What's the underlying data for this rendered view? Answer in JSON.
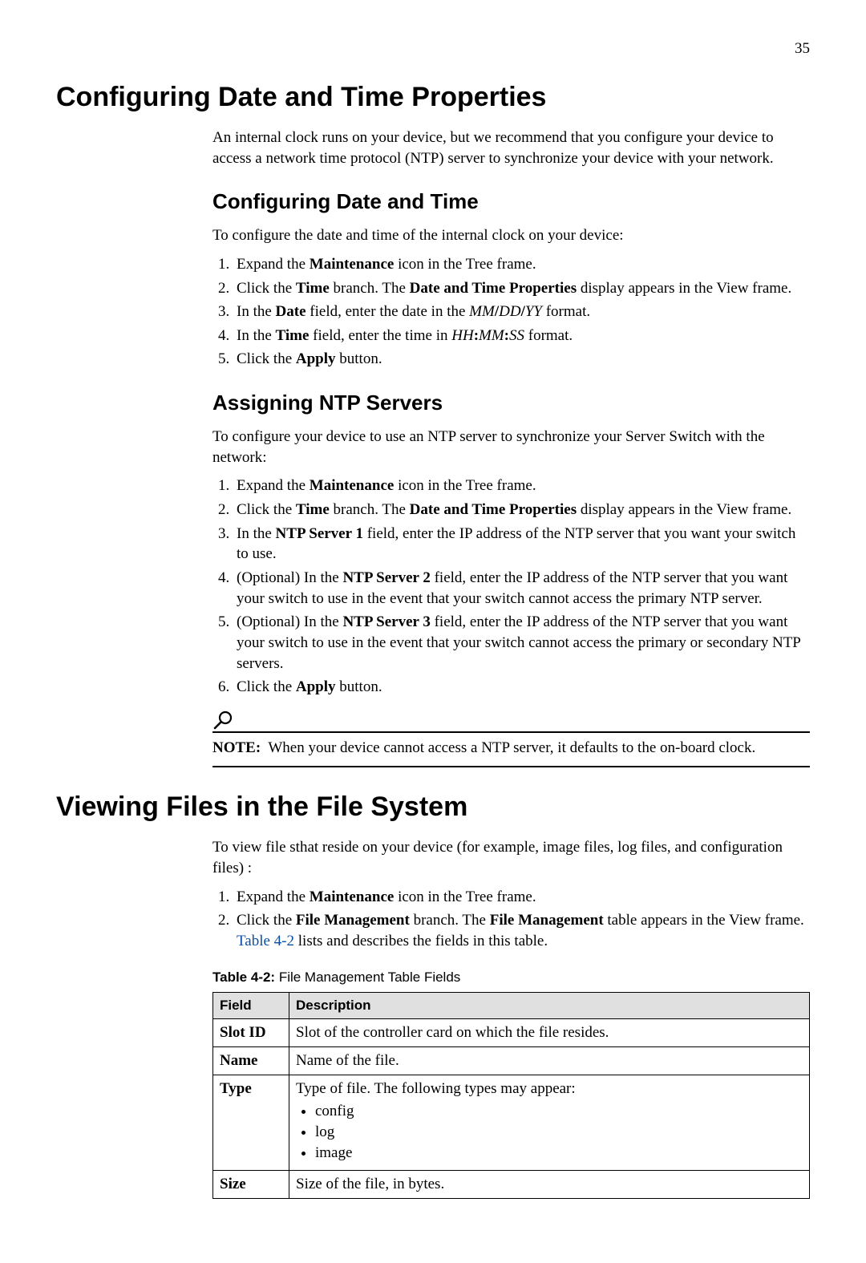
{
  "page_number": "35",
  "h1_a": "Configuring Date and Time Properties",
  "intro_a": "An internal clock runs on your device, but we recommend that you configure your device to access a network time protocol (NTP) server to synchronize your device with your network.",
  "h2_a": "Configuring Date and Time",
  "p_a": "To configure the date and time of the internal clock on your device:",
  "steps_a": [
    [
      {
        "t": "Expand the "
      },
      {
        "t": "Maintenance",
        "b": true
      },
      {
        "t": " icon in the Tree frame."
      }
    ],
    [
      {
        "t": "Click the "
      },
      {
        "t": "Time",
        "b": true
      },
      {
        "t": " branch. The "
      },
      {
        "t": "Date and Time Properties",
        "b": true
      },
      {
        "t": " display appears in the View frame."
      }
    ],
    [
      {
        "t": "In the "
      },
      {
        "t": "Date",
        "b": true
      },
      {
        "t": " field, enter the date in the "
      },
      {
        "t": "MM",
        "i": true
      },
      {
        "t": "/",
        "b": true
      },
      {
        "t": "DD",
        "i": true
      },
      {
        "t": "/",
        "b": true
      },
      {
        "t": "YY",
        "i": true
      },
      {
        "t": " format."
      }
    ],
    [
      {
        "t": "In the "
      },
      {
        "t": "Time",
        "b": true
      },
      {
        "t": " field, enter the time in "
      },
      {
        "t": "HH",
        "i": true
      },
      {
        "t": ":",
        "b": true
      },
      {
        "t": "MM",
        "i": true
      },
      {
        "t": ":",
        "b": true
      },
      {
        "t": "SS",
        "i": true
      },
      {
        "t": " format."
      }
    ],
    [
      {
        "t": "Click the "
      },
      {
        "t": "Apply",
        "b": true
      },
      {
        "t": " button."
      }
    ]
  ],
  "h2_b": "Assigning NTP Servers",
  "p_b": "To configure your device to use an NTP server to synchronize your Server Switch with the network:",
  "steps_b": [
    [
      {
        "t": "Expand the "
      },
      {
        "t": "Maintenance",
        "b": true
      },
      {
        "t": " icon in the Tree frame."
      }
    ],
    [
      {
        "t": "Click the "
      },
      {
        "t": "Time",
        "b": true
      },
      {
        "t": " branch. The "
      },
      {
        "t": "Date and Time Properties",
        "b": true
      },
      {
        "t": " display appears in the View frame."
      }
    ],
    [
      {
        "t": "In the "
      },
      {
        "t": "NTP Server 1",
        "b": true
      },
      {
        "t": " field, enter the IP address of the NTP server that you want your switch to use."
      }
    ],
    [
      {
        "t": "(Optional) In the "
      },
      {
        "t": "NTP Server 2",
        "b": true
      },
      {
        "t": " field, enter the IP address of the NTP server that you want your switch to use in the event that your switch cannot access the primary NTP server."
      }
    ],
    [
      {
        "t": "(Optional) In the "
      },
      {
        "t": "NTP Server 3",
        "b": true
      },
      {
        "t": " field, enter the IP address of the NTP server that you want your switch to use in the event that your switch cannot access the primary or secondary NTP servers."
      }
    ],
    [
      {
        "t": "Click the "
      },
      {
        "t": "Apply",
        "b": true
      },
      {
        "t": " button."
      }
    ]
  ],
  "note_label": "NOTE:",
  "note_text": "  When your device cannot access a NTP server, it defaults to the on-board clock.",
  "h1_b": "Viewing Files in the File System",
  "p_c": "To view file sthat reside on your device (for example, image files, log files, and configuration files) :",
  "steps_c": [
    [
      {
        "t": "Expand the "
      },
      {
        "t": "Maintenance",
        "b": true
      },
      {
        "t": " icon in the Tree frame."
      }
    ],
    [
      {
        "t": "Click the "
      },
      {
        "t": "File Management",
        "b": true
      },
      {
        "t": " branch. The "
      },
      {
        "t": "File Management",
        "b": true
      },
      {
        "t": " table appears in the View frame. "
      },
      {
        "t": "Table 4-2",
        "link": true
      },
      {
        "t": " lists and describes the fields in this table."
      }
    ]
  ],
  "table_caption_b": "Table 4-2:",
  "table_caption_t": " File Management Table Fields",
  "table": {
    "headers": [
      "Field",
      "Description"
    ],
    "rows": [
      {
        "field": "Slot ID",
        "desc": "Slot of the controller card on which the file resides."
      },
      {
        "field": "Name",
        "desc": "Name of the file."
      },
      {
        "field": "Type",
        "desc": "Type of file. The following types may appear:",
        "bullets": [
          "config",
          "log",
          "image"
        ]
      },
      {
        "field": "Size",
        "desc": "Size of the file, in bytes."
      }
    ]
  }
}
